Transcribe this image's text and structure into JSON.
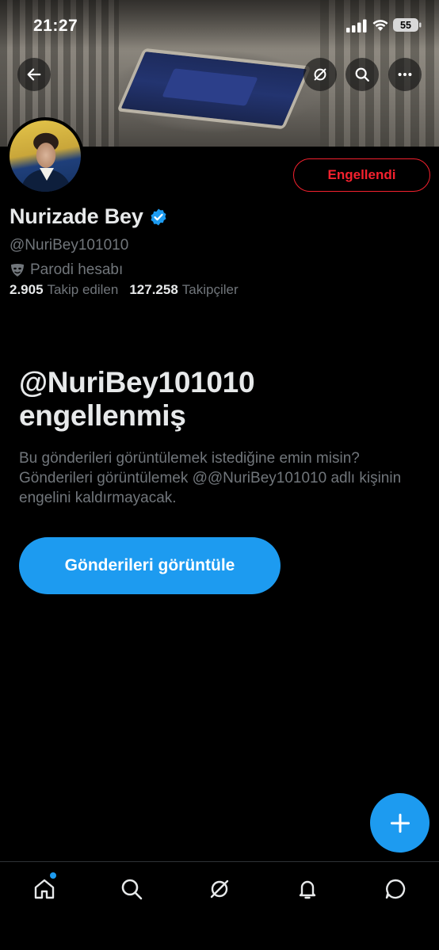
{
  "status_bar": {
    "time": "21:27",
    "battery": "55"
  },
  "header": {
    "back_icon": "arrow-left-icon",
    "grok_icon": "grok-slash-icon",
    "search_icon": "search-icon",
    "more_icon": "more-horizontal-icon"
  },
  "profile": {
    "name": "Nurizade Bey",
    "handle": "@NuriBey101010",
    "verified_color": "#1d9bf0",
    "parody_label": "Parodi hesabı",
    "following_count": "2.905",
    "following_label": "Takip edilen",
    "followers_count": "127.258",
    "followers_label": "Takipçiler",
    "blocked_button": "Engellendi"
  },
  "blocked_notice": {
    "title": "@NuriBey101010 engellenmiş",
    "body": "Bu gönderileri görüntülemek istediğine emin misin? Gönderileri görüntülemek @@NuriBey101010 adlı kişinin engelini kaldırmayacak.",
    "view_button": "Gönderileri görüntüle"
  },
  "bottom_nav": {
    "items": [
      "home-icon",
      "search-icon",
      "grok-icon",
      "notifications-icon",
      "messages-icon"
    ],
    "home_has_dot": true
  },
  "colors": {
    "accent": "#1d9bf0",
    "danger": "#f4212e",
    "secondary_text": "#71767b",
    "primary_text": "#e7e9ea"
  }
}
